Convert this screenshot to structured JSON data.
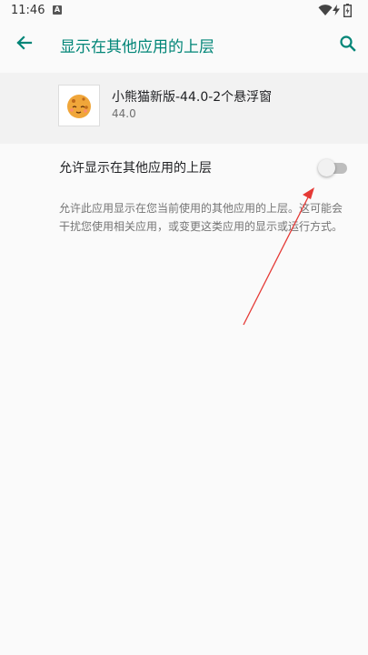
{
  "status_bar": {
    "time": "11:46",
    "notification_icon": "A",
    "wifi_icon": "wifi-icon",
    "battery_icon": "battery-charging-icon"
  },
  "app_bar": {
    "title": "显示在其他应用的上层",
    "back_icon": "arrow-back-icon",
    "search_icon": "search-icon",
    "accent_color": "#008577"
  },
  "app_info": {
    "name": "小熊猫新版-44.0-2个悬浮窗",
    "version": "44.0",
    "icon": "app-icon-cookie-face"
  },
  "setting": {
    "label": "允许显示在其他应用的上层",
    "enabled": false,
    "description": "允许此应用显示在您当前使用的其他应用的上层。这可能会干扰您使用相关应用，或变更这类应用的显示或运行方式。"
  },
  "annotation": {
    "type": "red-arrow-icon",
    "color": "#e53935"
  }
}
